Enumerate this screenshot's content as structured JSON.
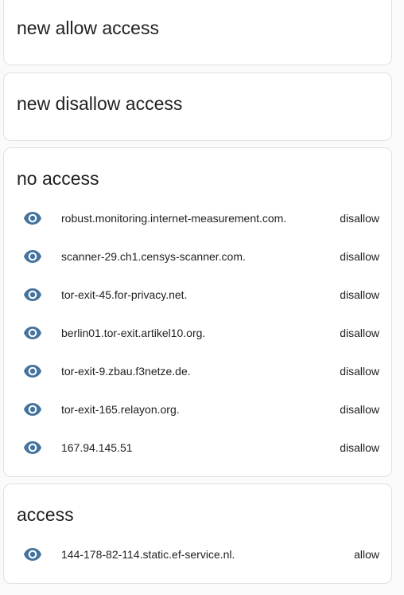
{
  "icon_color": "#44739e",
  "cards": {
    "new_allow": {
      "title": "new allow access"
    },
    "new_disallow": {
      "title": "new disallow access"
    },
    "no_access": {
      "title": "no access",
      "items": [
        {
          "icon": "eye-icon",
          "host": "robust.monitoring.internet-measurement.com.",
          "action": "disallow"
        },
        {
          "icon": "eye-icon",
          "host": "scanner-29.ch1.censys-scanner.com.",
          "action": "disallow"
        },
        {
          "icon": "eye-icon",
          "host": "tor-exit-45.for-privacy.net.",
          "action": "disallow"
        },
        {
          "icon": "eye-icon",
          "host": "berlin01.tor-exit.artikel10.org.",
          "action": "disallow"
        },
        {
          "icon": "eye-icon",
          "host": "tor-exit-9.zbau.f3netze.de.",
          "action": "disallow"
        },
        {
          "icon": "eye-icon",
          "host": "tor-exit-165.relayon.org.",
          "action": "disallow"
        },
        {
          "icon": "eye-icon",
          "host": "167.94.145.51",
          "action": "disallow"
        }
      ]
    },
    "access": {
      "title": "access",
      "items": [
        {
          "icon": "eye-icon",
          "host": "144-178-82-114.static.ef-service.nl.",
          "action": "allow"
        }
      ]
    }
  }
}
